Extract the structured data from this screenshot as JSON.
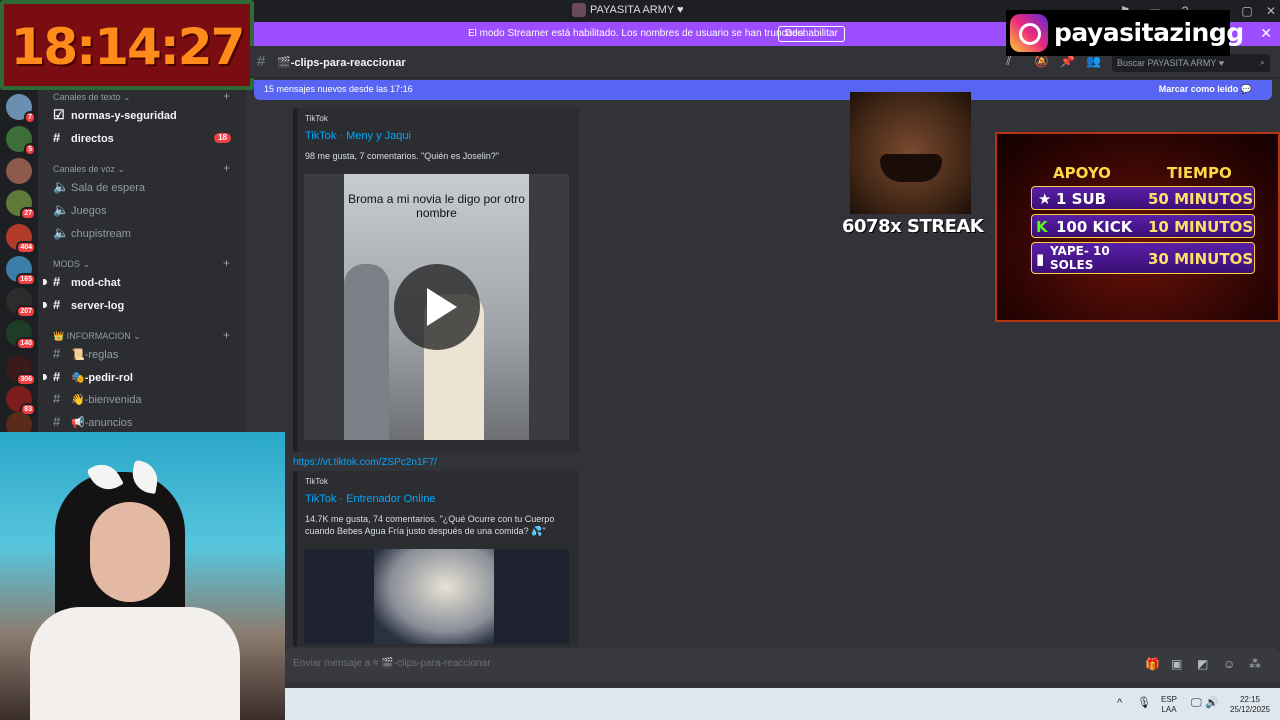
{
  "window": {
    "title": "PAYASITA ARMY ♥"
  },
  "streamer_banner": {
    "message": "El modo Streamer está habilitado. Los nombres de usuario se han truncado.",
    "button": "Deshabilitar"
  },
  "clock_overlay": {
    "time": "18:14:27"
  },
  "server_badges": [
    "7",
    "5",
    "27",
    "404",
    "165",
    "207",
    "140",
    "306",
    "83"
  ],
  "sidebar": {
    "cat_text": "Canales de texto",
    "text_channels": [
      {
        "label": "normas-y-seguridad"
      },
      {
        "label": "directos",
        "count": "18"
      }
    ],
    "cat_voice": "Canales de voz",
    "voice_channels": [
      {
        "label": "Sala de espera"
      },
      {
        "label": "Juegos"
      },
      {
        "label": "chupistream"
      }
    ],
    "cat_mods": "MODS",
    "mod_channels": [
      {
        "label": "mod-chat"
      },
      {
        "label": "server-log"
      }
    ],
    "cat_info": "INFORMACION",
    "info_channels": [
      {
        "label": "📜-reglas"
      },
      {
        "label": "🎭-pedir-rol"
      },
      {
        "label": "👋-bienvenida"
      },
      {
        "label": "📢-anuncios"
      }
    ]
  },
  "header": {
    "channel": "🎬-clips-para-reaccionar",
    "search_placeholder": "Buscar PAYASITA ARMY ♥"
  },
  "new_messages": {
    "text": "15 mensajes nuevos desde las 17:16",
    "mark_read": "Marcar como leído"
  },
  "messages": [
    {
      "provider": "TikTok",
      "title": "TikTok · Meny y Jaqui",
      "description": "98 me gusta, 7 comentarios. \"Quién es Joselin?\"",
      "video_caption": "Broma a mi novia le digo por otro nombre"
    },
    {
      "link": "https://vt.tiktok.com/ZSPc2n1F7/",
      "provider": "TikTok",
      "title": "TikTok · Entrenador Online",
      "description": "14.7K me gusta, 74 comentarios. \"¿Qué Ocurre con tu Cuerpo cuando Bebes Agua Fría justo después de una comida? 💦\""
    }
  ],
  "composer": {
    "placeholder": "Enviar mensaje a # 🎬-clips-para-reaccionar"
  },
  "taskbar": {
    "lang": "ESP",
    "layout": "LAA",
    "time": "22:15",
    "date": "25/12/2025"
  },
  "overlays": {
    "instagram_handle": "payasitazingg",
    "streak": "6078x STREAK",
    "support_table": {
      "col1": "APOYO",
      "col2": "TIEMPO",
      "rows": [
        {
          "item": "1 SUB",
          "time": "50 MINUTOS"
        },
        {
          "item": "100 KICK",
          "time": "10 MINUTOS"
        },
        {
          "item": "YAPE- 10 SOLES",
          "time": "30 MINUTOS"
        }
      ]
    }
  },
  "colors": {
    "accent": "#5865f2",
    "streamer": "#9b4dff",
    "link": "#00a8fc",
    "badge": "#f23f43"
  }
}
